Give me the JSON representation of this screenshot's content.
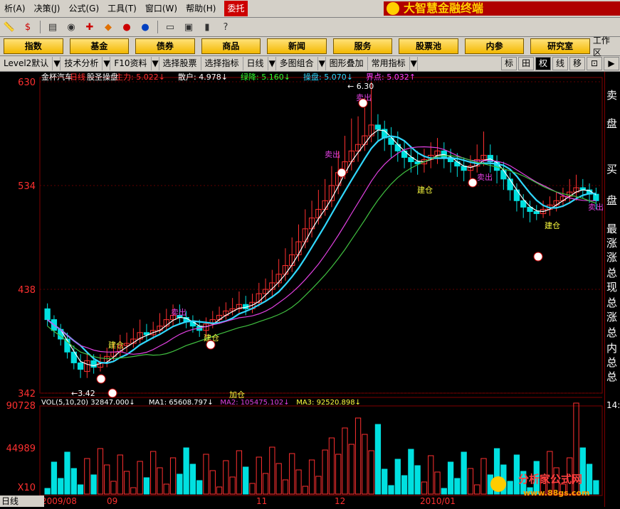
{
  "menu": [
    "析(A)",
    "决策(J)",
    "公式(G)",
    "工具(T)",
    "窗口(W)",
    "帮助(H)",
    "委托"
  ],
  "brand": "大智慧金融终端",
  "toolbar_icons": [
    "ruler-icon",
    "dollar-icon",
    "list-icon",
    "binocular-icon",
    "puzzle-icon",
    "arrow-diamond-icon",
    "circle-red-icon",
    "circle-blue-icon",
    "doc-icon",
    "window-icon",
    "bar-icon",
    "help-cursor-icon"
  ],
  "nav": [
    "指数",
    "基金",
    "债券",
    "商品",
    "新闻",
    "服务",
    "股票池",
    "内参",
    "研究室"
  ],
  "nav_end": "工作区",
  "subbar": [
    "Level2默认",
    "技术分析",
    "F10资料",
    "选择股票",
    "选择指标",
    "日线",
    "多图组合",
    "图形叠加",
    "常用指标"
  ],
  "right_btns": [
    "标",
    "田",
    "权",
    "线",
    "移",
    "⊡",
    "▶"
  ],
  "price_axis": [
    "630",
    "534",
    "438",
    "342"
  ],
  "vol_axis": [
    "90728",
    "44989",
    "X10"
  ],
  "dates": [
    "2009/08",
    "09",
    "11",
    "12",
    "2010/01"
  ],
  "chart_title": {
    "stock": "金杯汽车",
    "period": "日线",
    "name": "股圣操盘",
    "zl_label": "主力: 5.022↓",
    "sh_label": "散户: 4.978↓",
    "lj_label": "绿降: 5.160↓",
    "cp_label": "操盘: 5.070↓",
    "jd_label": "界点: 5.032↑"
  },
  "vol_title": {
    "vol": "VOL(5,10,20) 32847.000↓",
    "ma1": "MA1: 65608.797↓",
    "ma2": "MA2: 105475.102↓",
    "ma3": "MA3: 92520.898↓"
  },
  "annotations": {
    "high": "6.30",
    "low": "3.42",
    "build": "建仓",
    "sell": "卖出",
    "add": "加仓"
  },
  "right_panel": [
    "卖",
    "盘",
    "买",
    "盘",
    "最新",
    "涨跌",
    "涨幅",
    "总手",
    "现手",
    "总额",
    "涨停",
    "总笔",
    "内盘",
    "总买",
    "总卖"
  ],
  "right_time": "14:",
  "watermark": {
    "text": "分析家公式网",
    "url": "www.88gs.com"
  },
  "status": "日线",
  "chart_data": {
    "type": "candlestick",
    "y_ticks": [
      342,
      438,
      534,
      630
    ],
    "candles": [
      [
        420,
        410,
        425,
        404
      ],
      [
        410,
        400,
        414,
        394
      ],
      [
        401,
        392,
        406,
        386
      ],
      [
        392,
        380,
        398,
        374
      ],
      [
        380,
        370,
        386,
        364
      ],
      [
        370,
        364,
        378,
        356
      ],
      [
        362,
        372,
        380,
        356
      ],
      [
        372,
        366,
        378,
        360
      ],
      [
        366,
        370,
        378,
        362
      ],
      [
        370,
        376,
        384,
        366
      ],
      [
        376,
        380,
        388,
        372
      ],
      [
        380,
        386,
        396,
        376
      ],
      [
        386,
        388,
        398,
        380
      ],
      [
        388,
        392,
        402,
        384
      ],
      [
        392,
        398,
        410,
        388
      ],
      [
        398,
        396,
        406,
        390
      ],
      [
        396,
        400,
        408,
        392
      ],
      [
        400,
        404,
        416,
        396
      ],
      [
        404,
        410,
        420,
        400
      ],
      [
        410,
        414,
        424,
        404
      ],
      [
        414,
        412,
        424,
        406
      ],
      [
        412,
        408,
        418,
        402
      ],
      [
        408,
        404,
        414,
        398
      ],
      [
        404,
        400,
        410,
        394
      ],
      [
        400,
        406,
        412,
        394
      ],
      [
        406,
        410,
        418,
        402
      ],
      [
        410,
        414,
        422,
        406
      ],
      [
        414,
        418,
        426,
        410
      ],
      [
        418,
        420,
        430,
        414
      ],
      [
        420,
        424,
        436,
        416
      ],
      [
        424,
        420,
        432,
        414
      ],
      [
        420,
        426,
        434,
        416
      ],
      [
        426,
        434,
        444,
        422
      ],
      [
        434,
        438,
        448,
        428
      ],
      [
        438,
        444,
        456,
        432
      ],
      [
        444,
        452,
        466,
        440
      ],
      [
        452,
        460,
        476,
        446
      ],
      [
        460,
        470,
        486,
        454
      ],
      [
        470,
        482,
        498,
        464
      ],
      [
        482,
        494,
        512,
        476
      ],
      [
        494,
        504,
        520,
        486
      ],
      [
        504,
        512,
        530,
        498
      ],
      [
        512,
        520,
        540,
        506
      ],
      [
        520,
        534,
        552,
        514
      ],
      [
        534,
        546,
        566,
        526
      ],
      [
        546,
        556,
        580,
        540
      ],
      [
        556,
        566,
        596,
        548
      ],
      [
        566,
        572,
        598,
        556
      ],
      [
        572,
        580,
        606,
        566
      ],
      [
        580,
        590,
        630,
        574
      ],
      [
        590,
        586,
        600,
        574
      ],
      [
        586,
        578,
        594,
        566
      ],
      [
        578,
        572,
        588,
        560
      ],
      [
        572,
        566,
        584,
        556
      ],
      [
        566,
        560,
        576,
        550
      ],
      [
        560,
        556,
        570,
        546
      ],
      [
        556,
        554,
        566,
        544
      ],
      [
        554,
        558,
        568,
        546
      ],
      [
        558,
        562,
        574,
        550
      ],
      [
        562,
        566,
        578,
        554
      ],
      [
        566,
        560,
        574,
        550
      ],
      [
        560,
        556,
        568,
        546
      ],
      [
        556,
        552,
        564,
        542
      ],
      [
        552,
        548,
        560,
        538
      ],
      [
        548,
        552,
        562,
        540
      ],
      [
        552,
        558,
        572,
        546
      ],
      [
        558,
        562,
        584,
        552
      ],
      [
        562,
        556,
        572,
        546
      ],
      [
        556,
        548,
        562,
        536
      ],
      [
        548,
        540,
        556,
        530
      ],
      [
        540,
        530,
        546,
        520
      ],
      [
        530,
        520,
        536,
        510
      ],
      [
        520,
        514,
        526,
        504
      ],
      [
        514,
        510,
        520,
        500
      ],
      [
        510,
        508,
        516,
        502
      ],
      [
        508,
        512,
        520,
        504
      ],
      [
        512,
        516,
        524,
        506
      ],
      [
        516,
        520,
        528,
        510
      ],
      [
        520,
        524,
        532,
        514
      ],
      [
        524,
        528,
        540,
        518
      ],
      [
        528,
        532,
        544,
        520
      ],
      [
        532,
        530,
        540,
        522
      ],
      [
        530,
        526,
        536,
        518
      ],
      [
        526,
        520,
        532,
        512
      ]
    ]
  }
}
